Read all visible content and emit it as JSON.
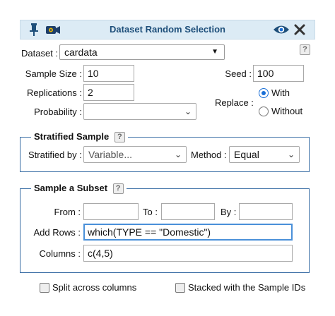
{
  "window": {
    "title": "Dataset Random Selection"
  },
  "dataset": {
    "label": "Dataset :",
    "value": "cardata",
    "help": "?"
  },
  "sample_size": {
    "label": "Sample Size :",
    "value": "10"
  },
  "seed": {
    "label": "Seed :",
    "value": "100"
  },
  "replications": {
    "label": "Replications :",
    "value": "2"
  },
  "replace": {
    "label": "Replace :",
    "options": [
      {
        "label": "With",
        "selected": true
      },
      {
        "label": "Without",
        "selected": false
      }
    ]
  },
  "probability": {
    "label": "Probability :",
    "value": ""
  },
  "stratified": {
    "legend": "Stratified Sample",
    "help": "?",
    "by_label": "Stratified by :",
    "by_placeholder": "Variable...",
    "method_label": "Method :",
    "method_value": "Equal"
  },
  "subset": {
    "legend": "Sample a Subset",
    "help": "?",
    "from_label": "From :",
    "from_value": "",
    "to_label": "To :",
    "to_value": "",
    "by_label": "By :",
    "by_value": "",
    "add_rows_label": "Add Rows :",
    "add_rows_value": "which(TYPE == \"Domestic\")",
    "columns_label": "Columns :",
    "columns_value": "c(4,5)"
  },
  "options": {
    "split_label": "Split across columns",
    "stacked_label": "Stacked with the Sample IDs"
  },
  "colors": {
    "title_text": "#1e4f7a",
    "title_bg": "#dcebf5",
    "fieldset_border": "#3a6ea5",
    "radio_accent": "#1a6fd6"
  }
}
